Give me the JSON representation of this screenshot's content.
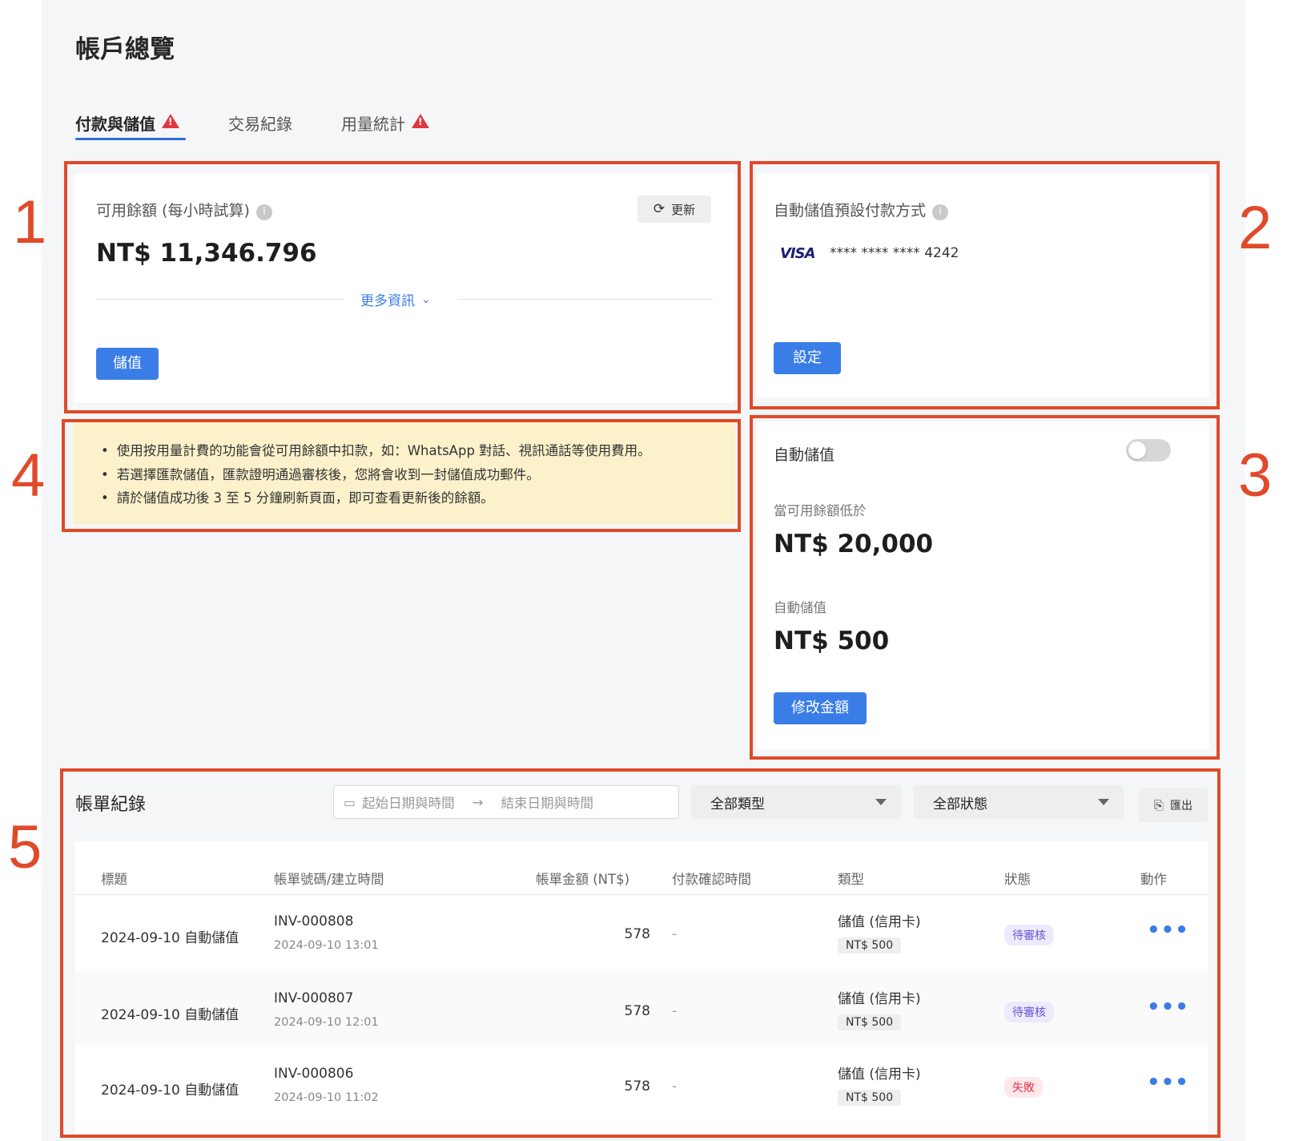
{
  "page_title": "帳戶總覽",
  "tabs": [
    {
      "label": "付款與儲值",
      "active": true,
      "warning": true
    },
    {
      "label": "交易紀錄",
      "active": false,
      "warning": false
    },
    {
      "label": "用量統計",
      "active": false,
      "warning": true
    }
  ],
  "markers": [
    "1",
    "2",
    "3",
    "4",
    "5"
  ],
  "balance_card": {
    "label": "可用餘額 (每小時試算)",
    "refresh_label": "更新",
    "amount": "NT$ 11,346.796",
    "more_info": "更多資訊",
    "topup_label": "儲值"
  },
  "payment_card": {
    "label": "自動儲值預設付款方式",
    "card_brand": "VISA",
    "card_number": "**** **** **** 4242",
    "settings_label": "設定"
  },
  "autotopup_card": {
    "label": "自動儲值",
    "toggle_on": false,
    "threshold_label": "當可用餘額低於",
    "threshold_amount": "NT$ 20,000",
    "topup_label": "自動儲值",
    "topup_amount": "NT$ 500",
    "modify_label": "修改金額"
  },
  "notice": [
    "使用按用量計費的功能會從可用餘額中扣款，如：WhatsApp 對話、視訊通話等使用費用。",
    "若選擇匯款儲值，匯款證明通過審核後，您將會收到一封儲值成功郵件。",
    "請於儲值成功後 3 至 5 分鐘刷新頁面，即可查看更新後的餘額。"
  ],
  "billing": {
    "title": "帳單紀錄",
    "start_placeholder": "起始日期與時間",
    "arrow": "→",
    "end_placeholder": "結束日期與時間",
    "type_filter": "全部類型",
    "status_filter": "全部狀態",
    "export_label": "匯出",
    "columns": [
      "標題",
      "帳單號碼/建立時間",
      "帳單金額 (NT$)",
      "付款確認時間",
      "類型",
      "狀態",
      "動作"
    ],
    "rows": [
      {
        "title": "2024-09-10 自動儲值",
        "invoice": "INV-000808",
        "created": "2024-09-10 13:01",
        "amount": "578",
        "confirmed": "-",
        "type": "儲值 (信用卡)",
        "type_tag": "NT$ 500",
        "status": "待審核",
        "status_kind": "pending",
        "action": "•••"
      },
      {
        "title": "2024-09-10 自動儲值",
        "invoice": "INV-000807",
        "created": "2024-09-10 12:01",
        "amount": "578",
        "confirmed": "-",
        "type": "儲值 (信用卡)",
        "type_tag": "NT$ 500",
        "status": "待審核",
        "status_kind": "pending",
        "action": "•••"
      },
      {
        "title": "2024-09-10 自動儲值",
        "invoice": "INV-000806",
        "created": "2024-09-10 11:02",
        "amount": "578",
        "confirmed": "-",
        "type": "儲值 (信用卡)",
        "type_tag": "NT$ 500",
        "status": "失敗",
        "status_kind": "failed",
        "action": "•••"
      }
    ]
  },
  "colors": {
    "primary": "#3a7de6",
    "annotation_red": "#e04a2a",
    "warning_red": "#e0383e",
    "notice_bg": "#fbf1ca"
  }
}
